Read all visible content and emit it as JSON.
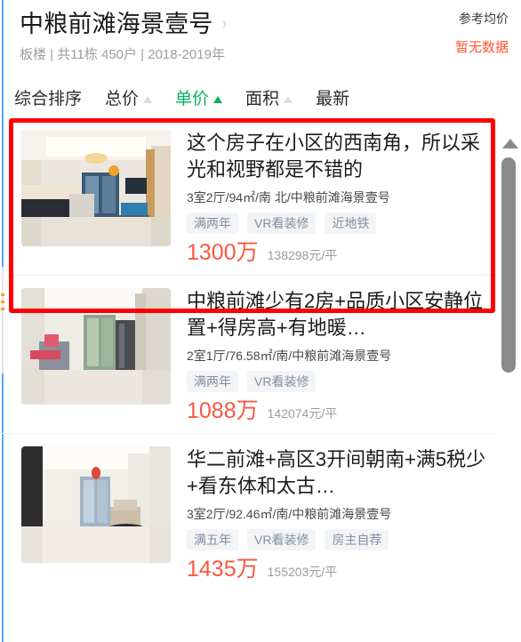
{
  "header": {
    "community_name": "中粮前滩海景壹号",
    "chevron": "›",
    "meta": "板楼 | 共11栋 450户 | 2018-2019年",
    "avg_price_label": "参考均价",
    "avg_price_value": "暂无数据",
    "avg_price_color": "#ff5533"
  },
  "sort_bar": {
    "items": [
      {
        "label": "综合排序",
        "has_arrow": false,
        "active": false
      },
      {
        "label": "总价",
        "has_arrow": true,
        "active": false
      },
      {
        "label": "单价",
        "has_arrow": true,
        "active": true
      },
      {
        "label": "面积",
        "has_arrow": true,
        "active": false
      },
      {
        "label": "最新",
        "has_arrow": false,
        "active": false
      }
    ],
    "active_color": "#07b35c",
    "inactive_arrow_color": "#d6dde4"
  },
  "listings": [
    {
      "title": "这个房子在小区的西南角，所以采光和视野都是不错的",
      "subtitle": "3室2厅/94㎡/南 北/中粮前滩海景壹号",
      "tags": [
        "满两年",
        "VR看装修",
        "近地铁"
      ],
      "total_price": "1300万",
      "unit_price": "138298元/平",
      "highlighted": true
    },
    {
      "title": "中粮前滩少有2房+品质小区安静位置+得房高+有地暖…",
      "subtitle": "2室1厅/76.58㎡/南/中粮前滩海景壹号",
      "tags": [
        "满两年",
        "VR看装修"
      ],
      "total_price": "1088万",
      "unit_price": "142074元/平",
      "highlighted": false
    },
    {
      "title": "华二前滩+高区3开间朝南+满5税少+看东体和太古…",
      "subtitle": "3室2厅/92.46㎡/南/中粮前滩海景壹号",
      "tags": [
        "满五年",
        "VR看装修",
        "房主自荐"
      ],
      "total_price": "1435万",
      "unit_price": "155203元/平",
      "highlighted": false
    }
  ],
  "highlight": {
    "color": "#fe0000"
  },
  "scrollbar": {
    "up_arrow_icon": "scroll-up-arrow-icon",
    "thumb_color": "#8a8a8a"
  }
}
